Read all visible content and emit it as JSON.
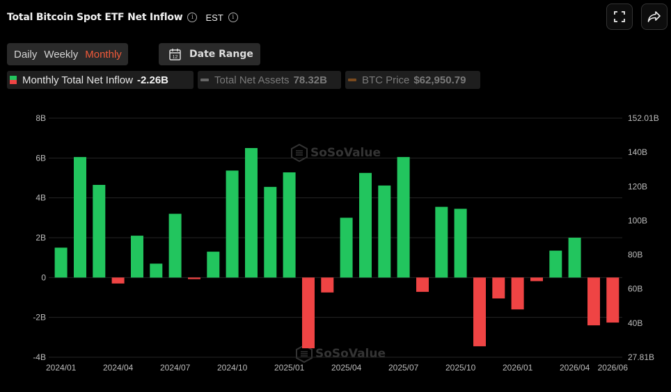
{
  "header": {
    "title": "Total Bitcoin Spot ETF Net Inflow",
    "timezone": "EST"
  },
  "toolbar": {
    "periods": [
      "Daily",
      "Weekly",
      "Monthly"
    ],
    "active_period": "Monthly",
    "date_range_label": "Date Range",
    "calendar_day": "12"
  },
  "legend": {
    "inflow_label": "Monthly Total Net Inflow",
    "inflow_value": "-2.26B",
    "assets_label": "Total Net Assets",
    "assets_value": "78.32B",
    "btc_label": "BTC Price",
    "btc_value": "$62,950.79"
  },
  "watermark": "SoSoValue",
  "colors": {
    "positive": "#22c55e",
    "negative": "#ef4444",
    "active_tab": "#f15a3a",
    "background": "#000000"
  },
  "chart_data": {
    "type": "bar",
    "title": "Total Bitcoin Spot ETF Net Inflow",
    "categories": [
      "2024/01",
      "2024/02",
      "2024/03",
      "2024/04",
      "2024/05",
      "2024/06",
      "2024/07",
      "2024/08",
      "2024/09",
      "2024/10",
      "2024/11",
      "2024/12",
      "2025/01",
      "2025/02",
      "2025/03",
      "2025/04",
      "2025/05",
      "2025/06",
      "2025/07",
      "2025/08",
      "2025/09",
      "2025/10",
      "2025/11",
      "2025/12",
      "2026/01",
      "2026/02",
      "2026/03",
      "2026/04",
      "2026/05",
      "2026/06"
    ],
    "series": [
      {
        "name": "Monthly Total Net Inflow",
        "values": [
          1.5,
          6.05,
          4.65,
          -0.3,
          2.1,
          0.7,
          3.2,
          -0.08,
          1.3,
          5.37,
          6.5,
          4.55,
          5.28,
          -3.55,
          -0.75,
          3.0,
          5.25,
          4.62,
          6.05,
          -0.72,
          3.55,
          3.45,
          -3.45,
          -1.05,
          -1.6,
          -0.18,
          1.35,
          2.0,
          -2.4,
          -2.26
        ]
      }
    ],
    "x_tick_labels": [
      "2024/01",
      "2024/04",
      "2024/07",
      "2024/10",
      "2025/01",
      "2025/04",
      "2025/07",
      "2025/10",
      "2026/01",
      "2026/04",
      "2026/06"
    ],
    "y_left_ticks": [
      "8B",
      "6B",
      "4B",
      "2B",
      "0",
      "-2B",
      "-4B"
    ],
    "y_left_range": [
      -4,
      8
    ],
    "y_right_ticks": [
      "152.01B",
      "140B",
      "120B",
      "100B",
      "80B",
      "60B",
      "40B",
      "27.81B"
    ],
    "y_right_range": [
      27.81,
      152.01
    ],
    "grid": "horizontal"
  }
}
